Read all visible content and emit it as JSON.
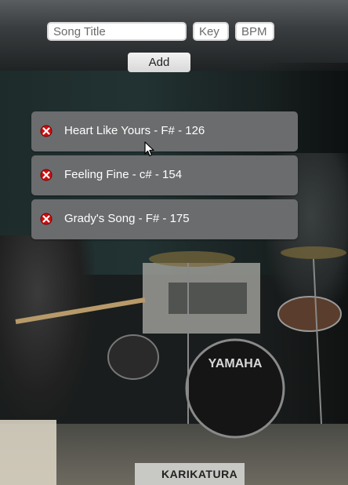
{
  "form": {
    "title_placeholder": "Song Title",
    "key_placeholder": "Key",
    "bpm_placeholder": "BPM",
    "add_label": "Add"
  },
  "songs": [
    {
      "text": "Heart Like Yours - F# - 126"
    },
    {
      "text": "Feeling Fine - c# - 154"
    },
    {
      "text": "Grady's Song - F# - 175"
    }
  ],
  "background": {
    "sign_text": "KARIKATURA",
    "drum_logo": "YAMAHA"
  },
  "colors": {
    "card": "#6a6c6e",
    "delete_icon": "#cc1111"
  },
  "icons": {
    "delete": "delete-icon"
  }
}
